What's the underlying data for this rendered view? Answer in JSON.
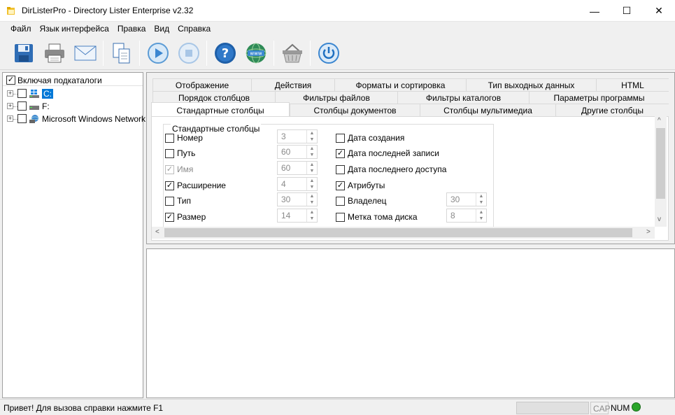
{
  "window": {
    "title": "DirListerPro - Directory Lister Enterprise v2.32",
    "controls": {
      "minimize": "—",
      "maximize": "☐",
      "close": "✕"
    }
  },
  "menu": [
    "Файл",
    "Язык интерфейса",
    "Правка",
    "Вид",
    "Справка"
  ],
  "toolbar": {
    "icons": [
      "save-icon",
      "print-icon",
      "email-icon",
      "copy-icon",
      "play-icon",
      "stop-icon",
      "help-icon",
      "web-icon",
      "basket-icon",
      "power-icon"
    ]
  },
  "tree": {
    "header_label": "Включая подкаталоги",
    "header_checked": true,
    "items": [
      {
        "label": "C:",
        "selected": true
      },
      {
        "label": "F:",
        "selected": false
      },
      {
        "label": "Microsoft Windows Network",
        "selected": false
      }
    ]
  },
  "tabs": {
    "row1": [
      "Отображение",
      "Действия",
      "Форматы и сортировка",
      "Тип выходных данных",
      "HTML"
    ],
    "row2": [
      "Порядок столбцов",
      "Фильтры файлов",
      "Фильтры каталогов",
      "Параметры программы"
    ],
    "row3": [
      "Стандартные столбцы",
      "Столбцы документов",
      "Столбцы мультимедиа",
      "Другие столбцы"
    ],
    "active": "Стандартные столбцы"
  },
  "standard_columns": {
    "group_title": "Стандартные столбцы",
    "left": [
      {
        "label": "Номер",
        "checked": false,
        "disabled": false,
        "value": "3"
      },
      {
        "label": "Путь",
        "checked": false,
        "disabled": false,
        "value": "60"
      },
      {
        "label": "Имя",
        "checked": true,
        "disabled": true,
        "value": "60"
      },
      {
        "label": "Расширение",
        "checked": true,
        "disabled": false,
        "value": "4"
      },
      {
        "label": "Тип",
        "checked": false,
        "disabled": false,
        "value": "30"
      },
      {
        "label": "Размер",
        "checked": true,
        "disabled": false,
        "value": "14"
      }
    ],
    "right": [
      {
        "label": "Дата создания",
        "checked": false,
        "value": ""
      },
      {
        "label": "Дата последней записи",
        "checked": true,
        "value": ""
      },
      {
        "label": "Дата последнего доступа",
        "checked": false,
        "value": ""
      },
      {
        "label": "Атрибуты",
        "checked": true,
        "value": ""
      },
      {
        "label": "Владелец",
        "checked": false,
        "value": "30"
      },
      {
        "label": "Метка тома диска",
        "checked": false,
        "value": "8"
      }
    ]
  },
  "status": {
    "text": "Привет! Для вызова справки нажмите F1",
    "cap": "CAP",
    "num": "NUM",
    "led_color": "#2aa52a"
  },
  "glyphs": {
    "check": "✓",
    "plus": "+",
    "up": "▲",
    "down": "▼",
    "left": "<",
    "right": ">",
    "vup": "^",
    "vdown": "v"
  }
}
